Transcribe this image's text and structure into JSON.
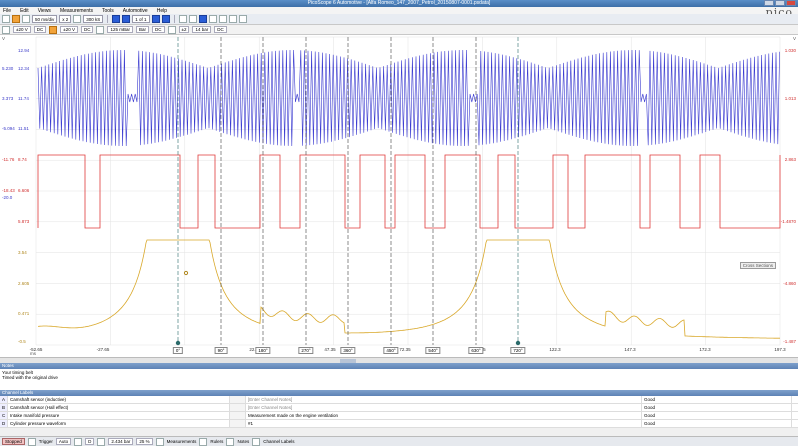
{
  "window": {
    "title": "PicoScope 6 Automotive - [Alfa Romeo_147_2007_Petrol_20150807-0001.psdata]"
  },
  "menu": [
    "File",
    "Edit",
    "Views",
    "Measurements",
    "Tools",
    "Automotive",
    "Help"
  ],
  "logo": "pico",
  "toolbar": {
    "timebase": "50 ms/div",
    "zoom": "x 2",
    "samples": "300 kS",
    "page": "1 of 1"
  },
  "channels": {
    "a_range": "±20 V",
    "a_coupling": "DC",
    "b_range": "±20 V",
    "b_coupling": "DC",
    "c_range": "125 mBar",
    "c_unit": "Bar",
    "c_coupling": "DC",
    "d_range": "±2",
    "d_unit": "14 bar",
    "d_coupling": "DC"
  },
  "axes": {
    "top_left_unit": "V",
    "blue_left": [
      "5.230",
      "3.373",
      "-5.094"
    ],
    "blue_right": [
      "12.94",
      "12.34",
      "11.74",
      "11.51"
    ],
    "red_left": [
      "-11.76",
      "-18.43",
      "-20.0"
    ],
    "red_right_inner": [
      "8.74",
      "6.606",
      "5.873"
    ],
    "gold_left": [
      "3.54",
      "2.605",
      "0.471",
      "-0.5"
    ],
    "right_unit": "V",
    "right_outer": [
      "1.030",
      "1.013",
      "2.863",
      "-1.4870",
      "-4.860",
      "-1.487"
    ],
    "x_ticks": [
      "-52.65",
      "-27.65",
      "22.35",
      "47.35",
      "72.35",
      "97.35",
      "122.3",
      "147.3",
      "172.3",
      "197.3"
    ],
    "x_unit": "ms",
    "angles": [
      "0°",
      "90°",
      "180°",
      "270°",
      "360°",
      "450°",
      "540°",
      "630°",
      "720°"
    ],
    "label_box": "Cross Sections"
  },
  "notes": {
    "header": "Notes",
    "lines": [
      "Your timing belt",
      "Timed with the original drive"
    ]
  },
  "channel_labels": {
    "header": "Channel Labels",
    "rows": [
      {
        "letter": "A",
        "desc": "Camshaft sensor (inductive)",
        "note": "[Enter Channel Notes]",
        "status": "Good"
      },
      {
        "letter": "B",
        "desc": "Camshaft sensor (Hall effect)",
        "note": "[Enter Channel Notes]",
        "status": "Good"
      },
      {
        "letter": "C",
        "desc": "Intake manifold pressure",
        "note": "Measurement made on the engine ventilation",
        "status": "Good"
      },
      {
        "letter": "D",
        "desc": "Cylinder pressure waveform",
        "note": "#1",
        "status": "Good"
      }
    ]
  },
  "statusbar": {
    "state": "Stopped",
    "trigger_label": "Trigger",
    "trigger_mode": "Auto",
    "trigger_channel": "D",
    "level": "2.434 bar",
    "pre": "25 %",
    "measurements": "Measurements",
    "rulers": "Rulers",
    "notes": "Notes",
    "channel_labels": "Channel Labels"
  },
  "colors": {
    "channel_a": "#3a3ad0",
    "channel_b": "#e03a3a",
    "channel_d": "#d9a82a",
    "marker": "#2a6a6a"
  }
}
